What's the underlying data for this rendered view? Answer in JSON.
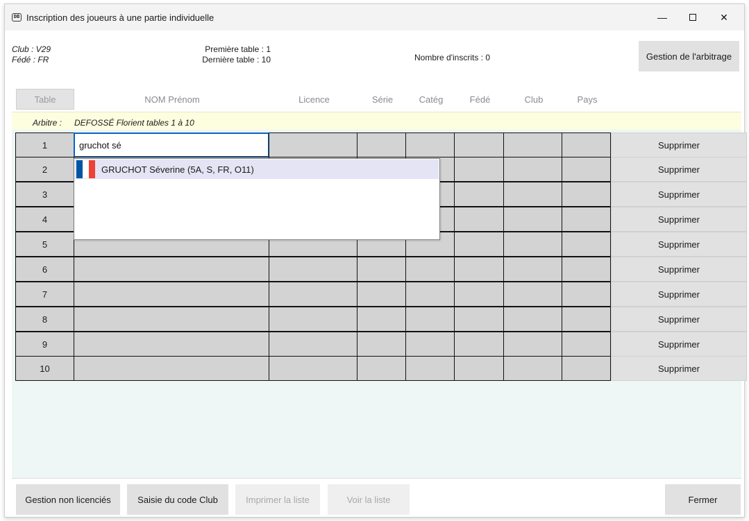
{
  "window": {
    "title": "Inscription des joueurs à une partie individuelle",
    "app_icon_text": "DB",
    "minimize": "—",
    "close": "✕"
  },
  "header": {
    "club": "Club : V29",
    "fede": "Fédé : FR",
    "premiere_table": "Première table : 1",
    "derniere_table": "Dernière table : 10",
    "nombre_inscrits": "Nombre d'inscrits : 0",
    "gestion_arbitrage": "Gestion de l'arbitrage"
  },
  "columns": [
    "Table",
    "NOM Prénom",
    "Licence",
    "Série",
    "Catég",
    "Fédé",
    "Club",
    "Pays"
  ],
  "arbitre": {
    "label": "Arbitre :",
    "value": "DEFOSSÉ Florient tables 1 à 10"
  },
  "search_input_value": "gruchot sé",
  "rows": [
    {
      "num": "1",
      "action": "Supprimer"
    },
    {
      "num": "2",
      "action": "Supprimer"
    },
    {
      "num": "3",
      "action": "Supprimer"
    },
    {
      "num": "4",
      "action": "Supprimer"
    },
    {
      "num": "5",
      "action": "Supprimer"
    },
    {
      "num": "6",
      "action": "Supprimer"
    },
    {
      "num": "7",
      "action": "Supprimer"
    },
    {
      "num": "8",
      "action": "Supprimer"
    },
    {
      "num": "9",
      "action": "Supprimer"
    },
    {
      "num": "10",
      "action": "Supprimer"
    }
  ],
  "suggestion": {
    "label": "GRUCHOT Séverine (5A, S, FR, O11)",
    "flag_icon": "france-flag-icon",
    "flag_colors": [
      "#0055a4",
      "#ffffff",
      "#ef4135"
    ]
  },
  "footer": {
    "gestion_non_licencies": "Gestion non licenciés",
    "saisie_code_club": "Saisie du code Club",
    "imprimer_liste": "Imprimer la liste",
    "voir_liste": "Voir la liste",
    "fermer": "Fermer"
  },
  "colors": {
    "cell": "#d3d3d3",
    "arbitre_band": "#fdfde0",
    "grid_background": "#eef6f6",
    "focus_border": "#0a62c4",
    "highlight": "#e4e4f4"
  }
}
